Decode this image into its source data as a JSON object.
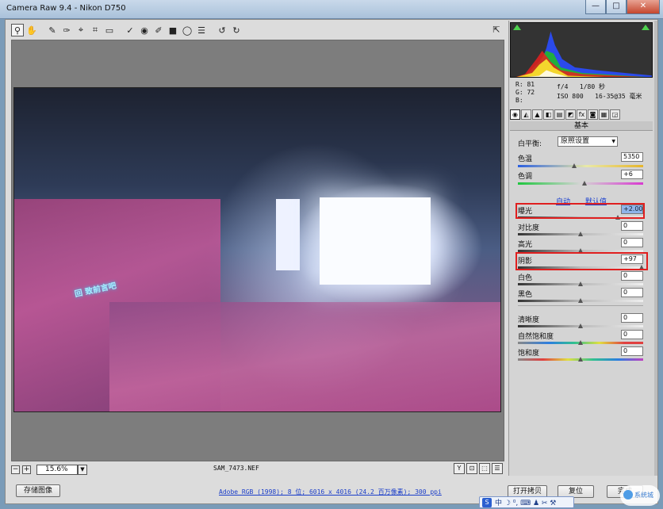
{
  "window": {
    "title": "Camera Raw 9.4 -  Nikon D750",
    "buttons": {
      "minimize": "—",
      "maximize": "□",
      "close": "✕"
    }
  },
  "toolbar": {
    "tools": [
      "zoom-icon",
      "hand-icon",
      "white-balance-icon",
      "color-sampler-icon",
      "targeted-adjust-icon",
      "crop-icon",
      "straighten-icon",
      "spot-removal-icon",
      "red-eye-icon",
      "adjustment-brush-icon",
      "graduated-filter-icon",
      "radial-filter-icon",
      "presets-list-icon",
      "rotate-left-icon",
      "rotate-right-icon"
    ],
    "glyphs": [
      "⚲",
      "✋",
      "✎",
      "✑",
      "⌖",
      "⌗",
      "▭",
      "✓",
      "◉",
      "✐",
      "■",
      "◯",
      "☰",
      "↺",
      "↻"
    ],
    "fullscreen_glyph": "⇱"
  },
  "preview": {
    "banner_text": "回 致前言吧",
    "zoom": "15.6%",
    "filename": "SAM_7473.NEF",
    "view_icons": [
      "Y",
      "⊡",
      "⬚",
      "☰"
    ]
  },
  "footer": {
    "save_label": "存储图像",
    "workflow_link": "Adobe RGB (1998); 8 位; 6016 x 4016 (24.2 百万像素); 300 ppi",
    "open_copy_label": "打开拷贝",
    "reset_label": "复位",
    "done_label": "完成"
  },
  "ime": {
    "logo": "S",
    "text": "中 ☽ ⁰, ⌨ ♟ ✂ ⚒"
  },
  "watermark": {
    "text": "系统城"
  },
  "histogram": {
    "colors": {
      "red": "#e62020",
      "green": "#20c020",
      "blue": "#2a4cff",
      "yellow": "#ffff30",
      "cyan": "#30e0e0",
      "magenta": "#e040e0",
      "white": "#ffffff"
    }
  },
  "readout": {
    "r": "R:  81",
    "g": "G:  72",
    "b": "B:",
    "aperture_shutter": "f/4   1/80 秒",
    "iso_lens": "ISO 800   16-35@35 毫米"
  },
  "panel_tabs": [
    "◉",
    "◭",
    "▲",
    "◧",
    "▤",
    "◩",
    "fx",
    "◙",
    "▦",
    "◲"
  ],
  "basic": {
    "header": "基本",
    "white_balance_label": "白平衡:",
    "white_balance_value": "原照设置",
    "temp": {
      "label": "色温",
      "value": "5350",
      "pos": 0.45
    },
    "tint": {
      "label": "色调",
      "value": "+6",
      "pos": 0.53
    },
    "auto_label": "自动",
    "default_label": "默认值",
    "exposure": {
      "label": "曝光",
      "value": "+2.00",
      "pos": 0.8
    },
    "contrast": {
      "label": "对比度",
      "value": "0",
      "pos": 0.5
    },
    "highlights": {
      "label": "高光",
      "value": "0",
      "pos": 0.5
    },
    "shadows": {
      "label": "阴影",
      "value": "+97",
      "pos": 0.985
    },
    "whites": {
      "label": "白色",
      "value": "0",
      "pos": 0.5
    },
    "blacks": {
      "label": "黑色",
      "value": "0",
      "pos": 0.5
    },
    "clarity": {
      "label": "清晰度",
      "value": "0",
      "pos": 0.5
    },
    "vibrance": {
      "label": "自然饱和度",
      "value": "0",
      "pos": 0.5
    },
    "saturation": {
      "label": "饱和度",
      "value": "0",
      "pos": 0.5
    }
  }
}
